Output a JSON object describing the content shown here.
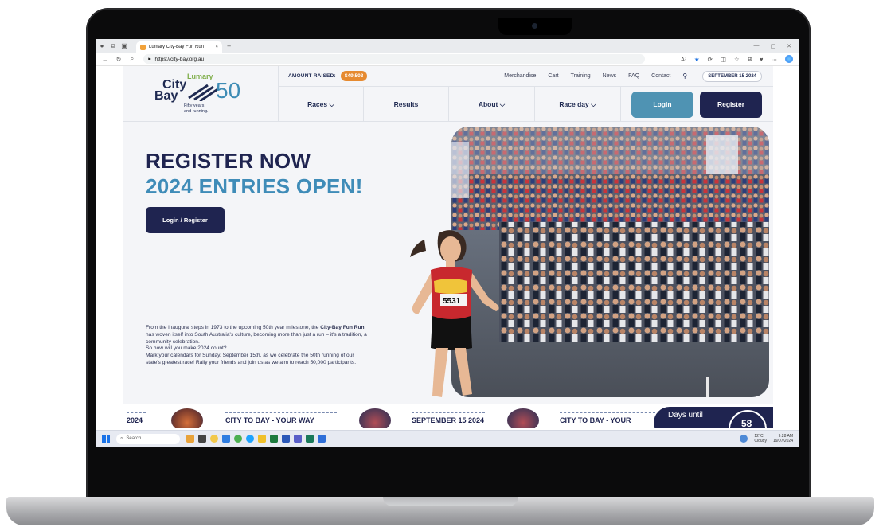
{
  "browser": {
    "tab_title": "Lumary City-Bay Fun Run",
    "tab_close": "×",
    "new_tab": "+",
    "url": "https://city-bay.org.au",
    "win_controls": [
      "—",
      "▢",
      "✕"
    ]
  },
  "site": {
    "logo": {
      "brand": "Lumary",
      "city": "City",
      "bay": "Bay",
      "number": "50",
      "tagline_1": "Fifty years",
      "tagline_2": "and running."
    },
    "util": {
      "amount_label": "AMOUNT RAISED:",
      "amount_value": "$49,503",
      "links": [
        "Merchandise",
        "Cart",
        "Training",
        "News",
        "FAQ",
        "Contact"
      ],
      "date": "SEPTEMBER 15 2024"
    },
    "nav": {
      "races": "Races ⌵",
      "results": "Results",
      "about": "About ⌵",
      "race_day": "Race day ⌵",
      "login": "Login",
      "register": "Register"
    },
    "hero": {
      "title_1": "REGISTER NOW",
      "title_2": "2024 ENTRIES OPEN!",
      "button": "Login / Register",
      "para_1a": "From the inaugural steps in 1973 to the upcoming 50th year milestone, the ",
      "para_1b": "City-Bay Fun Run",
      "para_1c": " has woven itself into South Australia's culture, becoming more than just a run – it's a tradition, a community celebration.",
      "para_2": "So how will you make 2024 count?",
      "para_3": "Mark your calendars for Sunday, September 15th, as we celebrate the 50th running of our state's greatest race! Rally your friends and join us as we aim to reach 50,000 participants.",
      "bib_number": "5531"
    },
    "strip": {
      "item_1": "2024",
      "item_2": "CITY TO BAY - YOUR WAY",
      "item_3": "SEPTEMBER 15 2024",
      "item_4": "CITY TO BAY - YOUR",
      "days_label": "Days until",
      "days_value": "58"
    }
  },
  "taskbar": {
    "search": "Search",
    "weather_temp": "12°C",
    "weather_desc": "Cloudy",
    "time": "9:28 AM",
    "date": "19/07/2024"
  },
  "colors": {
    "navy": "#1f2450",
    "teal": "#3f8cb8",
    "login_button": "#4f93b3",
    "amount_badge": "#e68a30"
  }
}
